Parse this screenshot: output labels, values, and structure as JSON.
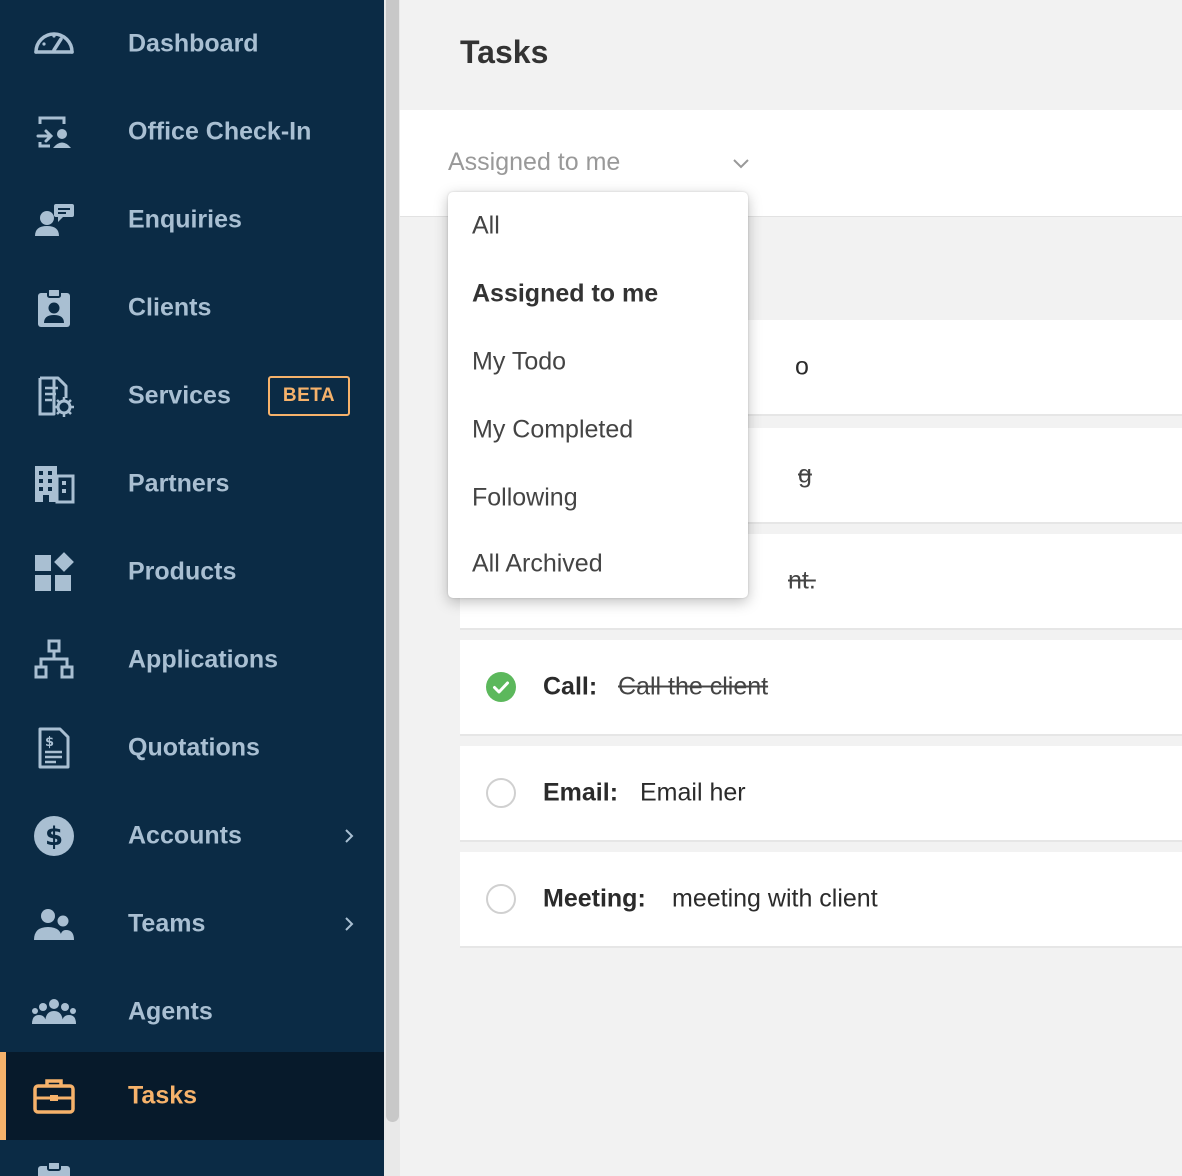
{
  "sidebar": {
    "items": [
      {
        "label": "Dashboard",
        "icon": "gauge-icon"
      },
      {
        "label": "Office Check-In",
        "icon": "check-in-icon"
      },
      {
        "label": "Enquiries",
        "icon": "enquiry-icon"
      },
      {
        "label": "Clients",
        "icon": "client-badge-icon"
      },
      {
        "label": "Services",
        "icon": "service-document-gear-icon",
        "badge": "BETA"
      },
      {
        "label": "Partners",
        "icon": "building-icon"
      },
      {
        "label": "Products",
        "icon": "products-grid-icon"
      },
      {
        "label": "Applications",
        "icon": "flow-chart-icon"
      },
      {
        "label": "Quotations",
        "icon": "quotation-document-icon"
      },
      {
        "label": "Accounts",
        "icon": "dollar-circle-icon"
      },
      {
        "label": "Teams",
        "icon": "team-icon"
      },
      {
        "label": "Agents",
        "icon": "agents-group-icon"
      },
      {
        "label": "Tasks",
        "icon": "briefcase-icon",
        "active": true
      }
    ]
  },
  "main": {
    "title": "Tasks",
    "filter": {
      "value": "Assigned to me",
      "options": [
        "All",
        "Assigned to me",
        "My Todo",
        "My Completed",
        "Following",
        "All Archived"
      ]
    },
    "tasks": [
      {
        "type": "",
        "description": "o",
        "done": false
      },
      {
        "type": "",
        "description": "g",
        "done": true
      },
      {
        "type": "",
        "description": "nt.",
        "done": true
      },
      {
        "type": "Call:",
        "description": "Call the client",
        "done": true
      },
      {
        "type": "Email:",
        "description": "Email her",
        "done": false
      },
      {
        "type": "Meeting:",
        "description": "meeting with client",
        "done": false
      }
    ]
  },
  "colors": {
    "sidebar_bg": "#0b2b45",
    "sidebar_active_bg": "#071a2b",
    "accent": "#f6b26b",
    "nav_text": "#a9bfd2",
    "check_done": "#5cb85c"
  }
}
